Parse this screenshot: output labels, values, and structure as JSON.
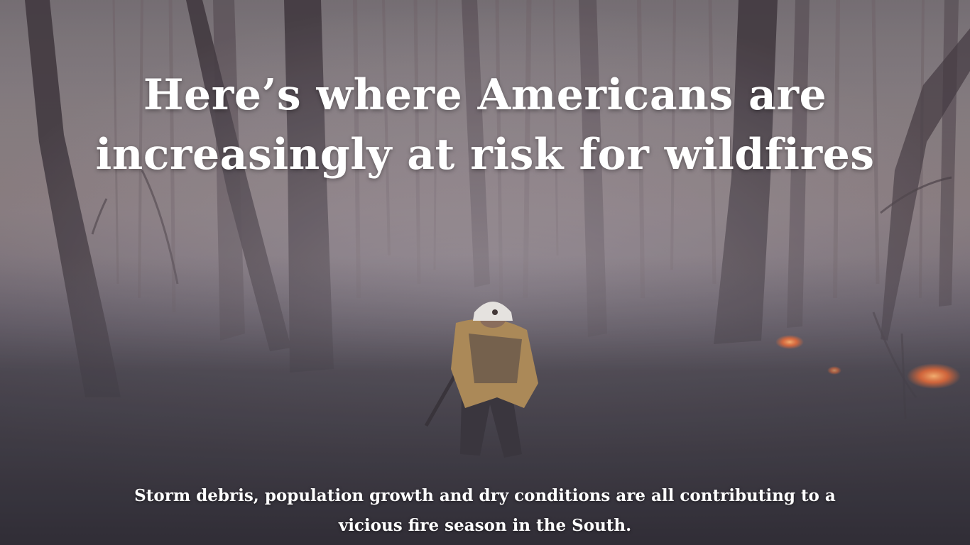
{
  "headline": "Here’s where Americans are increasingly at risk for wildfires",
  "dek": "Storm debris, population growth and dry conditions are all contributing to a vicious fire season in the South.",
  "photo": {
    "subject": "firefighter-in-smoky-forest",
    "colors": {
      "smoke": "#8f8a94",
      "canopy": "#6a5c58",
      "forest_floor": "#2d2b33",
      "trunk": "#3a3136",
      "fire": "#ff6a2a",
      "jacket": "#b08a50",
      "helmet": "#f2f0ea"
    }
  }
}
